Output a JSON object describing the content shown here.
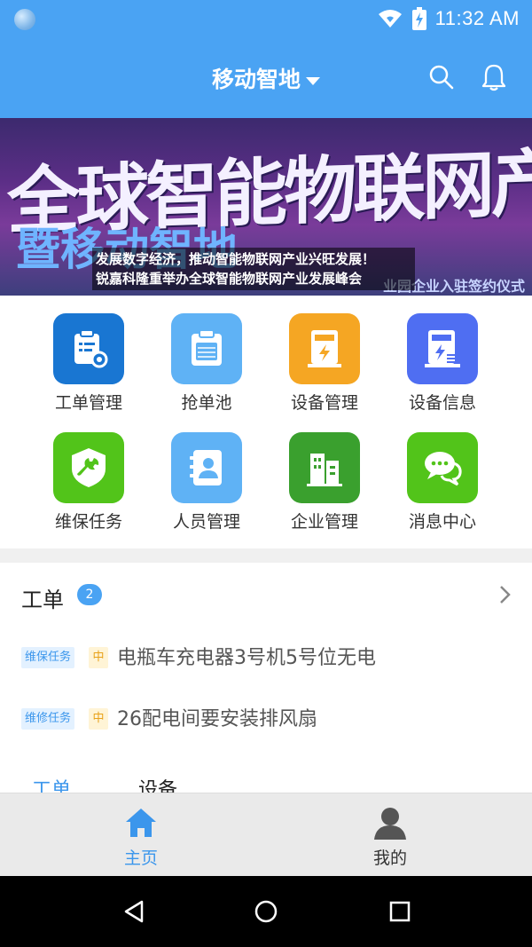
{
  "status": {
    "time": "11:32 AM"
  },
  "appbar": {
    "title": "移动智地"
  },
  "banner": {
    "headline": "全球智能物联网产业发展峰会",
    "subline": "暨移动智地",
    "right_text": "业园企业入驻签约仪式",
    "caption_line1": "发展数字经济，推动智能物联网产业兴旺发展！",
    "caption_line2": "锐嘉科隆重举办全球智能物联网产业发展峰会"
  },
  "grid": [
    {
      "label": "工单管理",
      "icon": "workorder-icon",
      "color": "#1976d2"
    },
    {
      "label": "抢单池",
      "icon": "clipboard-icon",
      "color": "#5fb2f5"
    },
    {
      "label": "设备管理",
      "icon": "charger-icon",
      "color": "#f5a623"
    },
    {
      "label": "设备信息",
      "icon": "charger-info-icon",
      "color": "#4f6ef2"
    },
    {
      "label": "维保任务",
      "icon": "wrench-shield-icon",
      "color": "#52c41a"
    },
    {
      "label": "人员管理",
      "icon": "contacts-icon",
      "color": "#5fb2f5"
    },
    {
      "label": "企业管理",
      "icon": "building-icon",
      "color": "#3aa02e"
    },
    {
      "label": "消息中心",
      "icon": "chat-icon",
      "color": "#52c41a"
    }
  ],
  "workorders": {
    "title": "工单",
    "badge": "2",
    "items": [
      {
        "type": "维保任务",
        "priority": "中",
        "text": "电瓶车充电器3号机5号位无电"
      },
      {
        "type": "维修任务",
        "priority": "中",
        "text": "26配电间要安装排风扇"
      }
    ]
  },
  "subtabs": {
    "tab1": "工单",
    "tab2": "设备"
  },
  "bottomnav": {
    "home": "主页",
    "mine": "我的"
  },
  "colors": {
    "primary": "#4aa3f3"
  }
}
